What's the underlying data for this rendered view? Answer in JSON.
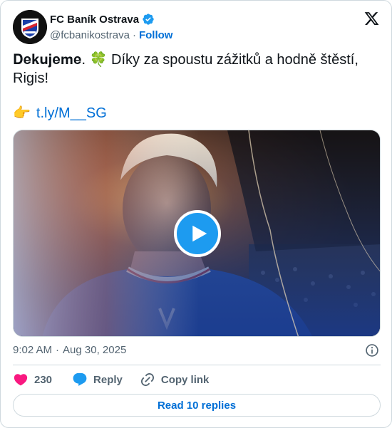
{
  "account": {
    "name": "FC Baník Ostrava",
    "handle": "@fcbanikostrava",
    "separator": "·",
    "follow_label": "Follow"
  },
  "tweet": {
    "line1": "𝐃𝐞𝐤𝐮𝐣𝐞𝐦𝐞. 🍀 Díky za spoustu zážitků a hodně štěstí,",
    "line2": "Rigis!",
    "link_emoji": "👉",
    "link_text": "t.ly/M__SG"
  },
  "meta": {
    "time": "9:02 AM",
    "separator": "·",
    "date": "Aug 30, 2025"
  },
  "actions": {
    "like_count": "230",
    "reply_label": "Reply",
    "copy_link_label": "Copy link"
  },
  "read_replies_label": "Read 10 replies",
  "icons": {
    "avatar": "club-crest",
    "verified": "verified-badge-icon",
    "brand": "x-logo-icon",
    "play": "play-icon",
    "info": "info-icon",
    "like": "heart-icon",
    "reply": "speech-bubble-icon",
    "copy": "link-icon"
  },
  "colors": {
    "link": "#006fd6",
    "verified": "#1d9bf0",
    "like": "#f91880",
    "muted": "#536471",
    "border": "#cfd9de"
  }
}
